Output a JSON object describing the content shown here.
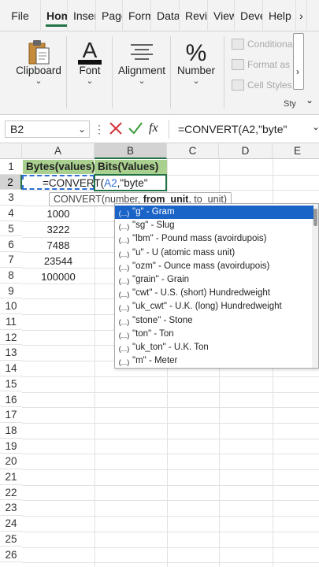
{
  "tabs": [
    {
      "label": "File"
    },
    {
      "label": "Hom"
    },
    {
      "label": "Inser"
    },
    {
      "label": "Page"
    },
    {
      "label": "Form"
    },
    {
      "label": "Data"
    },
    {
      "label": "Revie"
    },
    {
      "label": "View"
    },
    {
      "label": "Deve"
    },
    {
      "label": "Help"
    },
    {
      "label": "›"
    }
  ],
  "ribbon": {
    "clipboard": {
      "label": "Clipboard",
      "icon": "clipboard-icon"
    },
    "font": {
      "label": "Font",
      "icon": "font-color-icon"
    },
    "alignment": {
      "label": "Alignment",
      "icon": "align-icon"
    },
    "number": {
      "label": "Number",
      "icon": "percent-icon"
    },
    "conditional": "Conditiona",
    "format_as": "Format as",
    "cell_styles": "Cell Styles",
    "styles_label": "Sty",
    "more": "›"
  },
  "formula_bar": {
    "name_box": "B2",
    "dots": "⋮",
    "fx": "fx",
    "formula": "=CONVERT(A2,\"byte\""
  },
  "columns": [
    "A",
    "B",
    "C",
    "D",
    "E"
  ],
  "rows": [
    "1",
    "2",
    "3",
    "4",
    "5",
    "6",
    "7",
    "8",
    "9",
    "10",
    "11",
    "12",
    "13",
    "14",
    "15",
    "16",
    "17",
    "18",
    "19",
    "20",
    "21",
    "22",
    "23",
    "24",
    "25",
    "26"
  ],
  "cells": {
    "A1": "Bytes(values)",
    "B1": "Bits(Values)",
    "A4": "1000",
    "A5": "3222",
    "A6": "7488",
    "A7": "23544",
    "A8": "100000"
  },
  "edit": {
    "prefix": "=CONVERT(",
    "ref": "A2",
    "suffix": ",\"byte\""
  },
  "tooltip": {
    "func": "CONVERT(number, ",
    "current": "from_unit",
    "rest": ", to_unit)"
  },
  "autocomplete": {
    "icon_glyph": "(...)",
    "items": [
      "\"g\" - Gram",
      "\"sg\" - Slug",
      "\"lbm\" - Pound mass (avoirdupois)",
      "\"u\" - U (atomic mass unit)",
      "\"ozm\" - Ounce mass (avoirdupois)",
      "\"grain\" - Grain",
      "\"cwt\" - U.S. (short) Hundredweight",
      "\"uk_cwt\" - U.K. (long) Hundredweight",
      "\"stone\" - Stone",
      "\"ton\" - Ton",
      "\"uk_ton\" - U.K. Ton",
      "\"m\" - Meter"
    ]
  },
  "colors": {
    "accent": "#217346",
    "header_fill": "#a9d08e",
    "selection": "#1a63c7",
    "reference": "#2f6fd6"
  }
}
